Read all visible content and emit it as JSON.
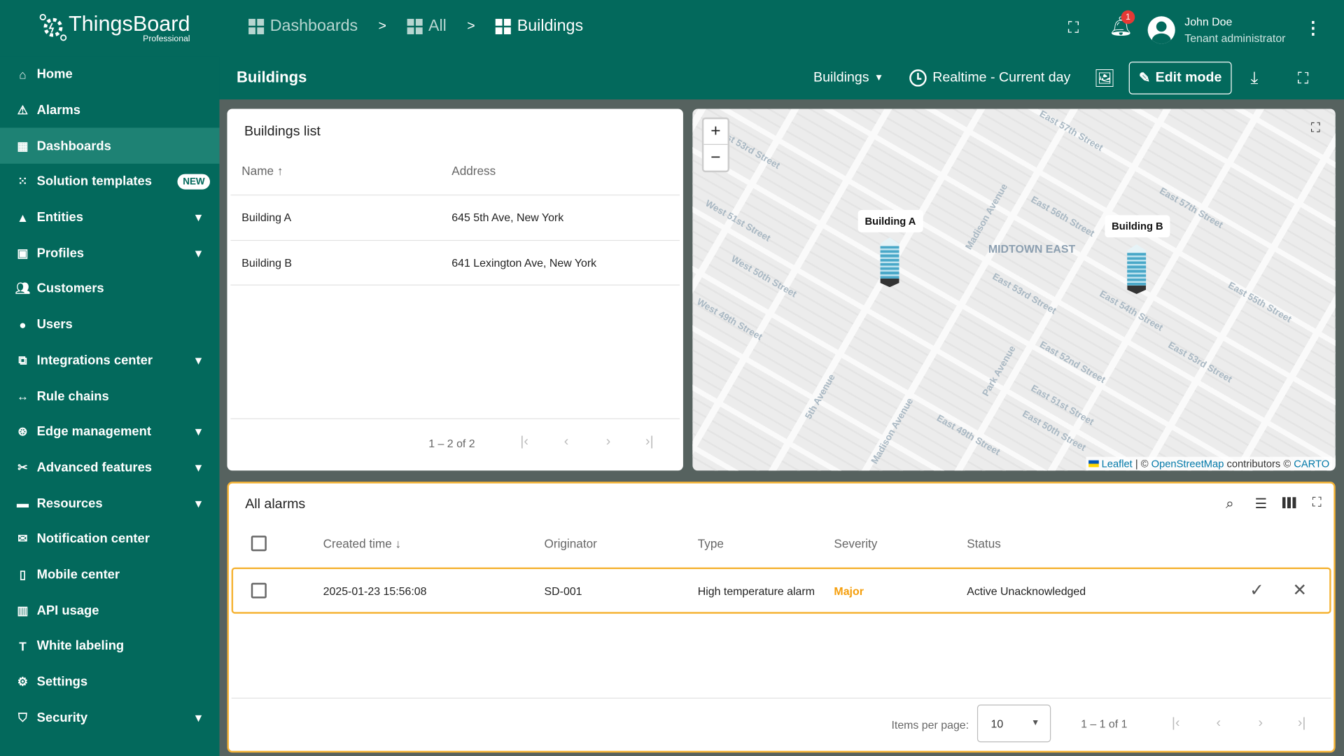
{
  "app": {
    "logo_name": "ThingsBoard",
    "logo_sub": "Professional"
  },
  "breadcrumb": [
    {
      "label": "Dashboards"
    },
    {
      "label": "All"
    },
    {
      "label": "Buildings"
    }
  ],
  "breadcrumb_sep": ">",
  "notifications": {
    "count": "1"
  },
  "user": {
    "name": "John Doe",
    "role": "Tenant administrator"
  },
  "dashboard": {
    "title": "Buildings",
    "state_select": "Buildings",
    "timewindow": "Realtime - Current day",
    "edit_label": "Edit mode"
  },
  "sidebar": {
    "items": [
      {
        "label": "Home",
        "icon": "home-icon"
      },
      {
        "label": "Alarms",
        "icon": "warning-icon"
      },
      {
        "label": "Dashboards",
        "icon": "dashboard-icon",
        "selected": true
      },
      {
        "label": "Solution templates",
        "icon": "apps-icon",
        "badge": "NEW"
      },
      {
        "label": "Entities",
        "icon": "category-icon",
        "expandable": true
      },
      {
        "label": "Profiles",
        "icon": "badge-icon",
        "expandable": true
      },
      {
        "label": "Customers",
        "icon": "group-icon"
      },
      {
        "label": "Users",
        "icon": "user-icon"
      },
      {
        "label": "Integrations center",
        "icon": "integration-icon",
        "expandable": true
      },
      {
        "label": "Rule chains",
        "icon": "rule-chain-icon"
      },
      {
        "label": "Edge management",
        "icon": "router-icon",
        "expandable": true
      },
      {
        "label": "Advanced features",
        "icon": "tools-icon",
        "expandable": true
      },
      {
        "label": "Resources",
        "icon": "folder-icon",
        "expandable": true
      },
      {
        "label": "Notification center",
        "icon": "notification-icon"
      },
      {
        "label": "Mobile center",
        "icon": "phone-icon"
      },
      {
        "label": "API usage",
        "icon": "chart-icon"
      },
      {
        "label": "White labeling",
        "icon": "format-paint-icon"
      },
      {
        "label": "Settings",
        "icon": "gear-icon"
      },
      {
        "label": "Security",
        "icon": "shield-icon",
        "expandable": true
      }
    ]
  },
  "buildings_list": {
    "title": "Buildings list",
    "columns": [
      "Name",
      "Address"
    ],
    "rows": [
      {
        "name": "Building A",
        "address": "645 5th Ave, New York"
      },
      {
        "name": "Building B",
        "address": "641 Lexington Ave, New York"
      }
    ],
    "pagination": "1 – 2 of 2"
  },
  "map": {
    "district": "MIDTOWN EAST",
    "markers": [
      "Building A",
      "Building B"
    ],
    "streets": [
      "West 53rd Street",
      "East 57th Street",
      "East 57th Street",
      "Madison Avenue",
      "East 56th Street",
      "West 51st Street",
      "West 50th Street",
      "East 53rd Street",
      "East 54th Street",
      "East 55th Street",
      "Park Avenue",
      "East 53rd Street",
      "5th Avenue",
      "Madison Avenue",
      "East 49th Street",
      "East 50th Street",
      "West 49th Street",
      "East 52nd Street",
      "East 51st Street"
    ],
    "attribution": {
      "leaflet": "Leaflet",
      "sep1": "| ©",
      "osm": "OpenStreetMap",
      "contrib": "contributors ©",
      "carto": "CARTO"
    }
  },
  "alarms": {
    "title": "All alarms",
    "columns": [
      "Created time",
      "Originator",
      "Type",
      "Severity",
      "Status"
    ],
    "rows": [
      {
        "created": "2025-01-23 15:56:08",
        "originator": "SD-001",
        "type": "High temperature alarm",
        "severity": "Major",
        "status": "Active Unacknowledged"
      }
    ],
    "items_per_page_label": "Items per page:",
    "items_per_page": "10",
    "pagination": "1 – 1 of 1",
    "severity_color": "#f59e0b"
  },
  "colors": {
    "primary": "#03695c",
    "accent": "#f5b335"
  }
}
